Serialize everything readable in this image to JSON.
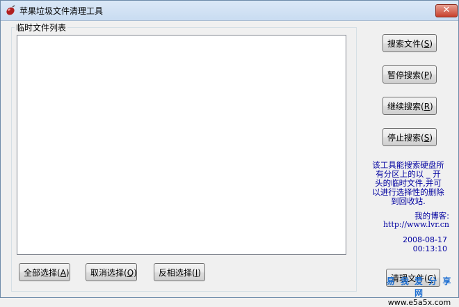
{
  "window": {
    "title": "苹果垃圾文件清理工具",
    "close_label": "✕"
  },
  "list_group": {
    "label": "临时文件列表",
    "items": []
  },
  "buttons": {
    "search": {
      "text": "搜索文件(",
      "key": "S",
      "end": ")"
    },
    "pause": {
      "text": "暂停搜索(",
      "key": "P",
      "end": ")"
    },
    "resume": {
      "text": "继续搜索(",
      "key": "R",
      "end": ")"
    },
    "stop": {
      "text": "停止搜索(",
      "key": "S",
      "end": ")"
    },
    "select_all": {
      "text": "全部选择(",
      "key": "A",
      "end": ")"
    },
    "deselect": {
      "text": "取消选择(",
      "key": "Q",
      "end": ")"
    },
    "invert": {
      "text": "反相选择(",
      "key": "I",
      "end": ")"
    },
    "clean": {
      "text": "清理文件(",
      "key": "C",
      "end": ")"
    }
  },
  "info": {
    "description_lines": [
      "该工具能搜索硬盘所",
      "有分区上的以 _ 开",
      "头的临时文件,并可",
      "以进行选择性的删除",
      "到回收站."
    ],
    "blog_label": "我的博客:",
    "blog_url": "http://www.lvr.cn",
    "date": "2008-08-17",
    "time": "00:13:10"
  },
  "watermark": {
    "line1": "易 我 爱 分 享 网",
    "line2": "www.e5a5x.com"
  },
  "colors": {
    "info_text": "#0000a0",
    "close_button": "#c7402c",
    "titlebar": "#c9dcf1"
  }
}
